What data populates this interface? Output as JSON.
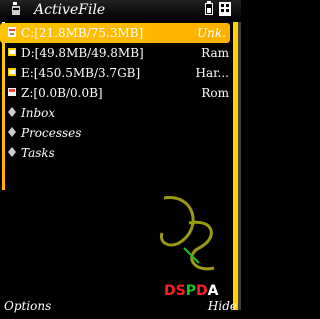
{
  "app": {
    "title": "ActiveFile"
  },
  "items": [
    {
      "label": "C:[21.8MB/75.3MB]",
      "type": "Unk.",
      "icon": "drive-c-icon",
      "selected": true
    },
    {
      "label": "D:[49.8MB/49.8MB]",
      "type": "Ram",
      "icon": "drive-d-icon"
    },
    {
      "label": "E:[450.5MB/3.7GB]",
      "type": "Har...",
      "icon": "drive-e-icon"
    },
    {
      "label": "Z:[0.0B/0.0B]",
      "type": "Rom",
      "icon": "drive-z-icon"
    },
    {
      "label": "Inbox",
      "type": "",
      "icon": "inbox-icon"
    },
    {
      "label": "Processes",
      "type": "",
      "icon": "processes-icon"
    },
    {
      "label": "Tasks",
      "type": "",
      "icon": "tasks-icon"
    }
  ],
  "logo": {
    "letters": [
      "D",
      "S",
      "P",
      "D",
      "A"
    ],
    "colors": [
      "#ff2020",
      "#ff2020",
      "#20c020",
      "#ff2020",
      "#ffffff"
    ]
  },
  "softkeys": {
    "left": "Options",
    "right": "Hide"
  },
  "colors": {
    "accent": "#ffc400",
    "background": "#000000"
  }
}
